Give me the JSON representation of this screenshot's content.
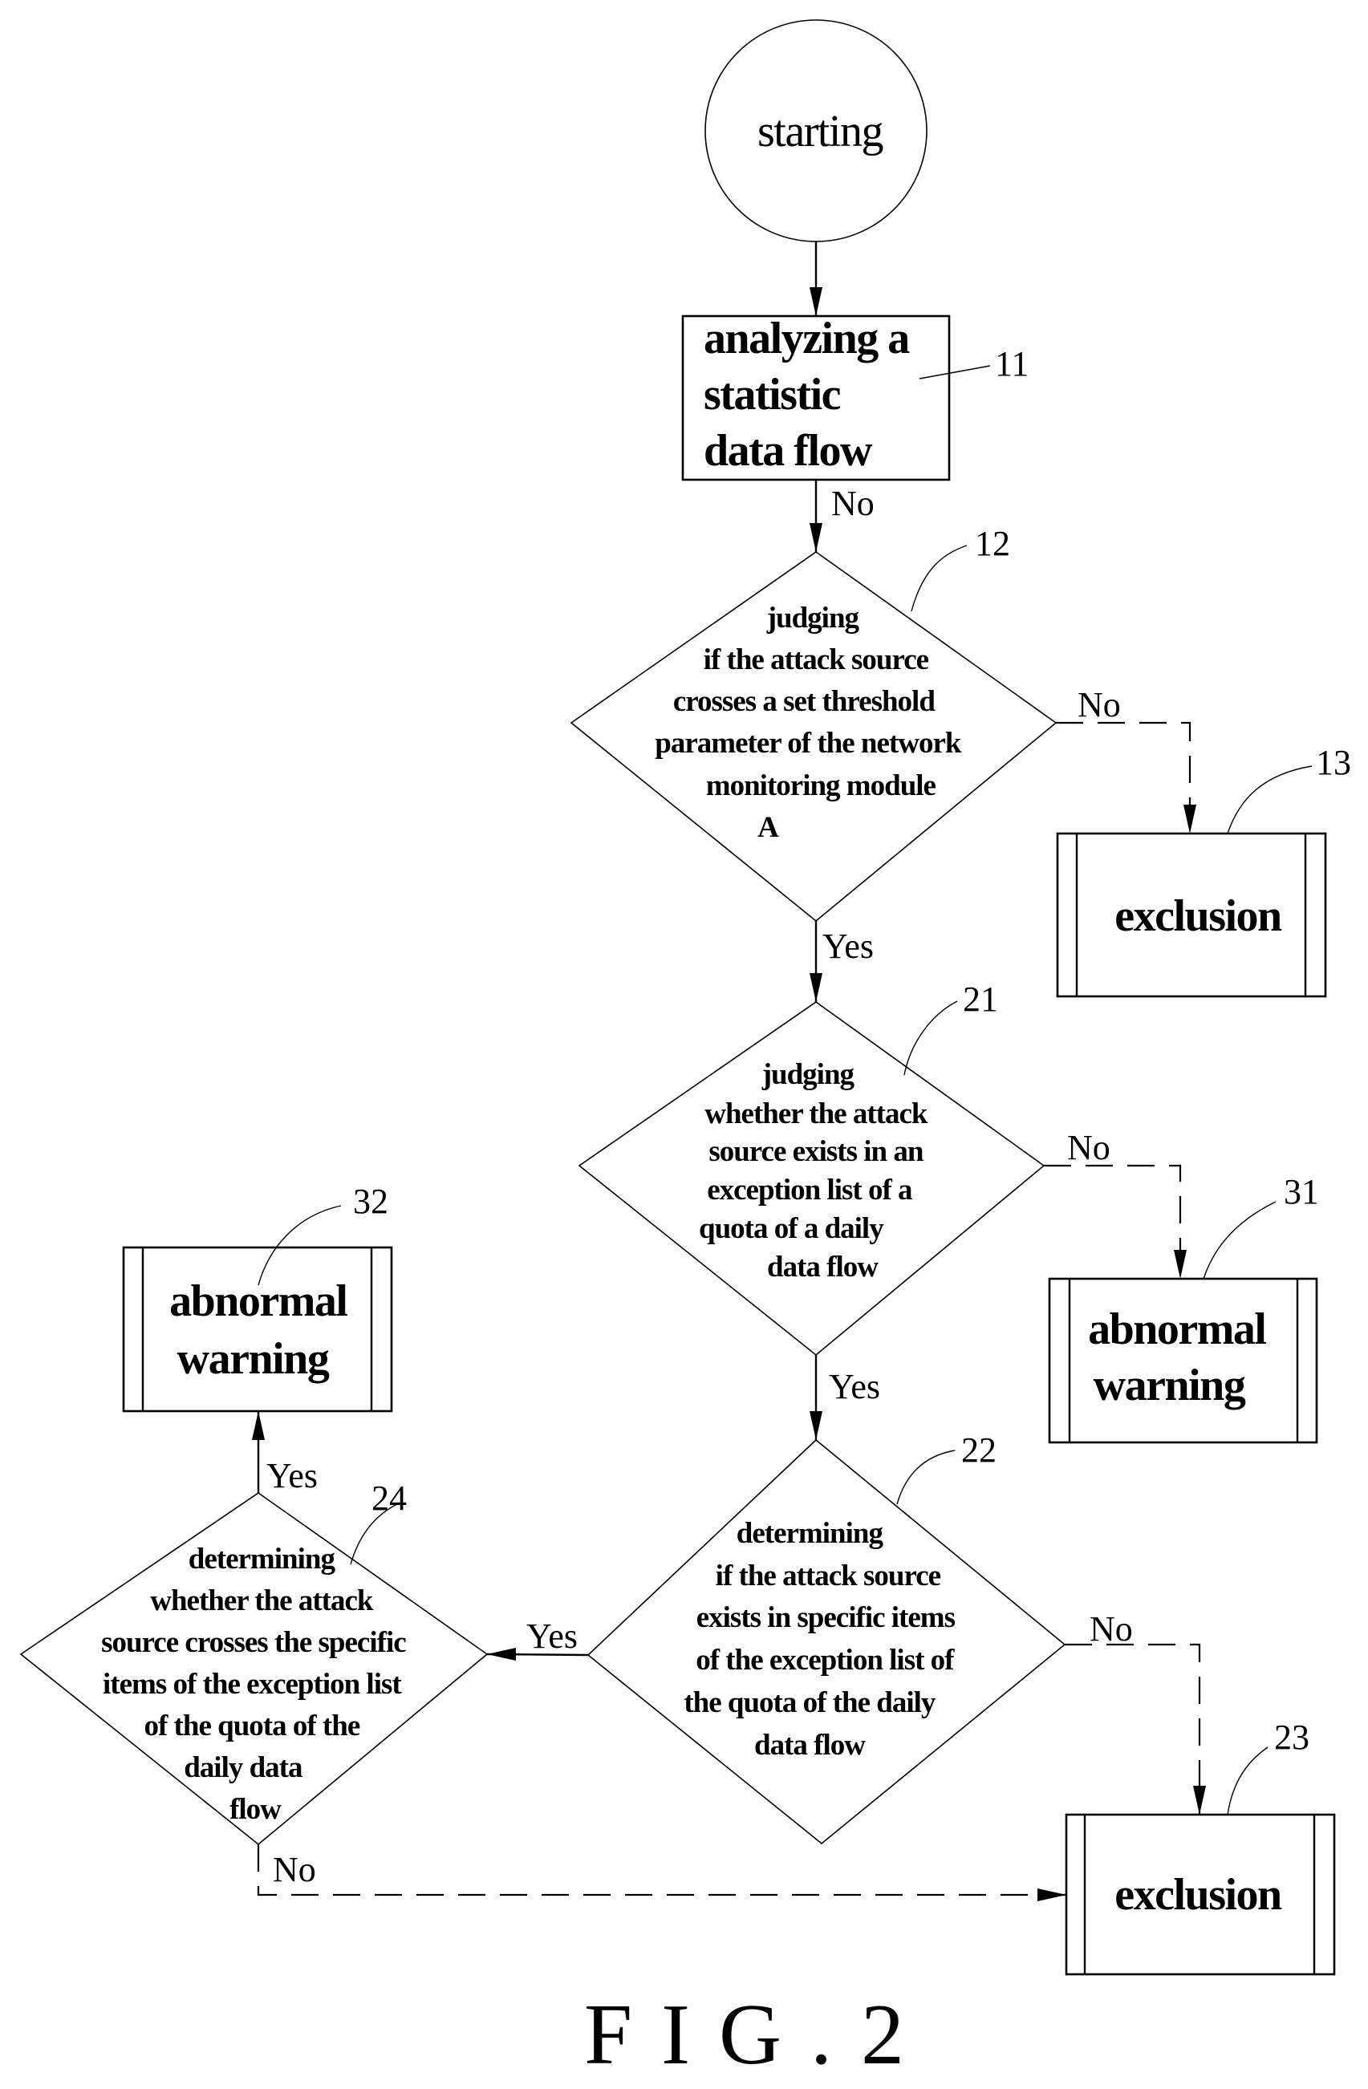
{
  "figure": {
    "caption": "FIG.2",
    "nodes": {
      "start": {
        "label": "starting"
      },
      "n11": {
        "ref": "11",
        "lines": [
          "analyzing a",
          "statistic",
          "data flow"
        ]
      },
      "n12": {
        "ref": "12",
        "lines": [
          "judging",
          "if the attack source",
          "crosses a set threshold",
          "parameter of the network",
          "monitoring module",
          "A"
        ]
      },
      "n13": {
        "ref": "13",
        "lines": [
          "exclusion"
        ]
      },
      "n21": {
        "ref": "21",
        "lines": [
          "judging",
          "whether the attack",
          "source exists in an",
          "exception list of a",
          "quota of a daily",
          "data flow"
        ]
      },
      "n31": {
        "ref": "31",
        "lines": [
          "abnormal",
          "warning"
        ]
      },
      "n22": {
        "ref": "22",
        "lines": [
          "determining",
          "if the attack source",
          "exists in specific items",
          "of the exception list of",
          "the quota of the daily",
          "data flow"
        ]
      },
      "n24": {
        "ref": "24",
        "lines": [
          "determining",
          "whether the attack",
          "source crosses the specific",
          "items of the exception list",
          "of the quota of the",
          "daily data",
          "flow"
        ]
      },
      "n32": {
        "ref": "32",
        "lines": [
          "abnormal",
          "warning"
        ]
      },
      "n23": {
        "ref": "23",
        "lines": [
          "exclusion"
        ]
      }
    },
    "edges": [
      {
        "id": "start-11",
        "from": "start",
        "to": "n11",
        "label": "",
        "style": "solid"
      },
      {
        "id": "11-12",
        "from": "n11",
        "to": "n12",
        "label": "No",
        "style": "solid"
      },
      {
        "id": "12-13",
        "from": "n12",
        "to": "n13",
        "label": "No",
        "style": "dashed"
      },
      {
        "id": "12-21",
        "from": "n12",
        "to": "n21",
        "label": "Yes",
        "style": "solid"
      },
      {
        "id": "21-31",
        "from": "n21",
        "to": "n31",
        "label": "No",
        "style": "dashed"
      },
      {
        "id": "21-22",
        "from": "n21",
        "to": "n22",
        "label": "Yes",
        "style": "solid"
      },
      {
        "id": "22-24",
        "from": "n22",
        "to": "n24",
        "label": "Yes",
        "style": "solid"
      },
      {
        "id": "22-23",
        "from": "n22",
        "to": "n23",
        "label": "No",
        "style": "dashed"
      },
      {
        "id": "24-32",
        "from": "n24",
        "to": "n32",
        "label": "Yes",
        "style": "solid"
      },
      {
        "id": "24-23",
        "from": "n24",
        "to": "n23",
        "label": "No",
        "style": "dashed"
      }
    ]
  }
}
